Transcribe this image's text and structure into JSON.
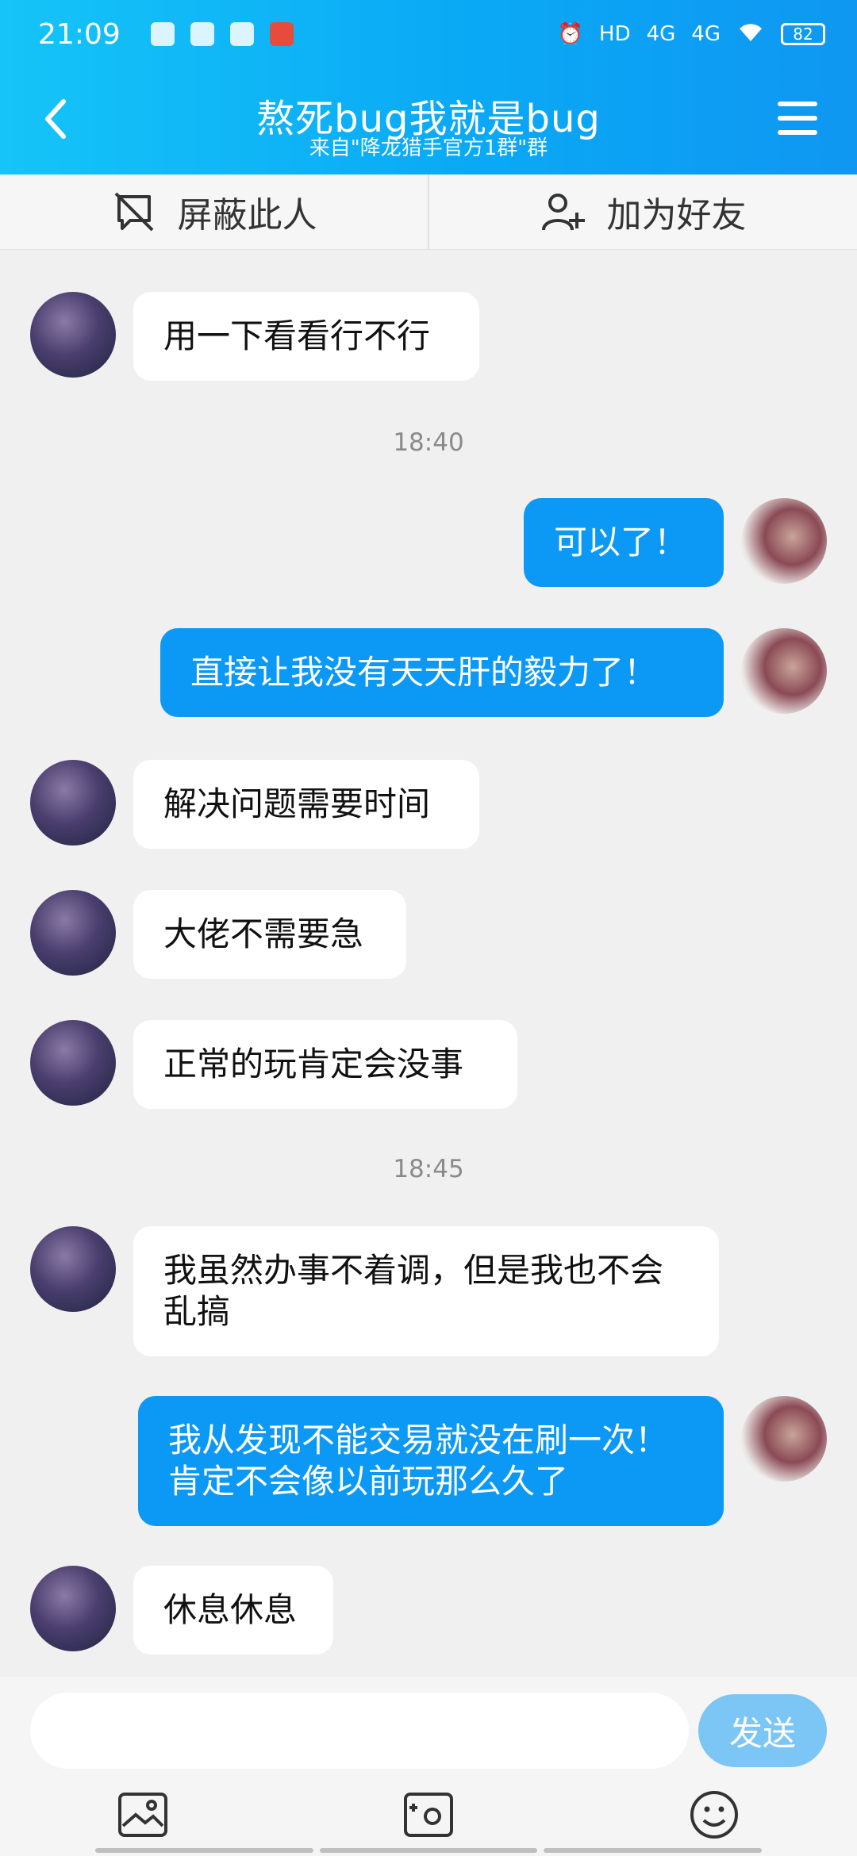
{
  "status_bar": {
    "time": "21:09",
    "network": "4G",
    "network2": "4G",
    "hd": "HD",
    "battery": "82"
  },
  "header": {
    "title": "熬死bug我就是bug",
    "subtitle": "来自\"降龙猎手官方1群\"群",
    "back_icon": "chevron-left-icon",
    "menu_icon": "hamburger-menu-icon"
  },
  "actions": {
    "block_label": "屏蔽此人",
    "add_friend_label": "加为好友"
  },
  "messages": [
    {
      "from": "other",
      "text": "用一下看看行不行"
    },
    {
      "type": "time",
      "text": "18:40"
    },
    {
      "from": "self",
      "text": "可以了！"
    },
    {
      "from": "self",
      "text": "直接让我没有天天肝的毅力了！"
    },
    {
      "from": "other",
      "text": "解决问题需要时间"
    },
    {
      "from": "other",
      "text": "大佬不需要急"
    },
    {
      "from": "other",
      "text": "正常的玩肯定会没事"
    },
    {
      "type": "time",
      "text": "18:45"
    },
    {
      "from": "other",
      "text": "我虽然办事不着调，但是我也不会乱搞"
    },
    {
      "from": "self",
      "text": "我从发现不能交易就没在刷一次！肯定不会像以前玩那么久了"
    },
    {
      "from": "other",
      "text": "休息休息"
    }
  ],
  "input": {
    "placeholder": "",
    "send_label": "发送"
  },
  "colors": {
    "header_start": "#15c4f8",
    "header_end": "#0f97f2",
    "self_bubble": "#0b99f5",
    "send_button": "#7cc6f6"
  }
}
